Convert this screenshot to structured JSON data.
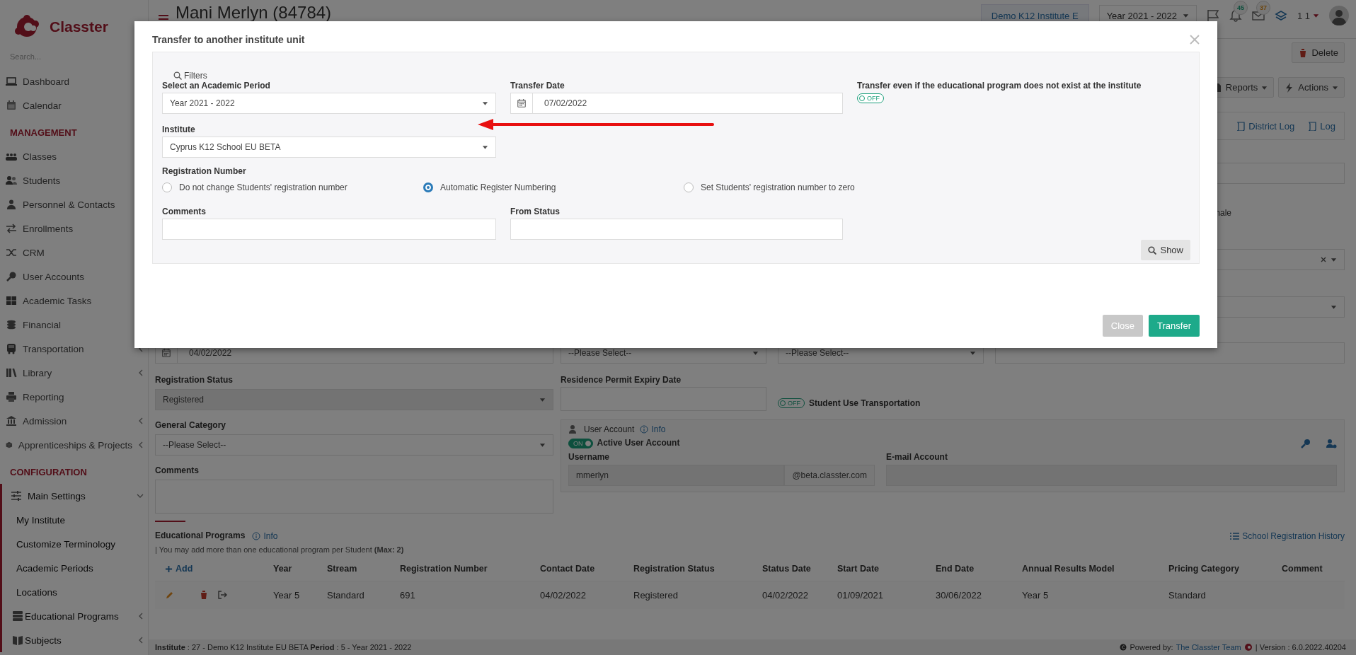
{
  "sidebar": {
    "logo_text": "Classter",
    "search": {
      "placeholder": "Search..."
    },
    "items": [
      {
        "kind": "item",
        "label": "Dashboard"
      },
      {
        "kind": "item",
        "label": "Calendar"
      },
      {
        "kind": "header",
        "label": "MANAGEMENT"
      },
      {
        "kind": "item",
        "label": "Classes"
      },
      {
        "kind": "item",
        "label": "Students"
      },
      {
        "kind": "item",
        "label": "Personnel & Contacts"
      },
      {
        "kind": "item",
        "label": "Enrollments"
      },
      {
        "kind": "item",
        "label": "CRM"
      },
      {
        "kind": "item",
        "label": "User Accounts"
      },
      {
        "kind": "item",
        "label": "Academic Tasks"
      },
      {
        "kind": "item",
        "label": "Financial"
      },
      {
        "kind": "item",
        "label": "Transportation",
        "expanded": false
      },
      {
        "kind": "item",
        "label": "Library",
        "expanded": false
      },
      {
        "kind": "item",
        "label": "Reporting"
      },
      {
        "kind": "item",
        "label": "Admission",
        "expanded": false
      },
      {
        "kind": "item",
        "label": "Apprenticeships & Projects",
        "expanded": false
      },
      {
        "kind": "header",
        "label": "CONFIGURATION"
      },
      {
        "kind": "item",
        "label": "Main Settings",
        "expanded": true,
        "children": [
          {
            "kind": "subitem",
            "label": "My Institute"
          },
          {
            "kind": "subitem",
            "label": "Customize Terminology"
          },
          {
            "kind": "subitem",
            "label": "Academic Periods"
          },
          {
            "kind": "subitem",
            "label": "Locations"
          },
          {
            "kind": "item",
            "label": "Educational Programs",
            "expanded": false
          },
          {
            "kind": "item",
            "label": "Subjects",
            "expanded": false
          }
        ]
      }
    ]
  },
  "header": {
    "title": "Mani Merlyn (84784)",
    "institute": "Demo K12 Institute E",
    "year": "Year 2021 - 2022",
    "notifications": "45",
    "messages": "37",
    "user": "1 1"
  },
  "page_actions": {
    "delete": "Delete",
    "reports": "Reports",
    "actions": "Actions",
    "district_log": "District Log",
    "log": "Log",
    "partial_label": "nale"
  },
  "student_form": {
    "row_fields": [
      {
        "kind": "date",
        "value": "04/02/2022"
      },
      {
        "kind": "select",
        "value": "--Please Select--"
      },
      {
        "kind": "select",
        "value": "--Please Select--"
      },
      {
        "kind": "input"
      }
    ],
    "registration_status": {
      "label": "Registration Status",
      "value": "Registered",
      "disabled": true
    },
    "residence_permit": {
      "label": "Residence Permit Expiry Date"
    },
    "transportation": {
      "label": "Student Use Transportation",
      "on": false,
      "toggle_text": "OFF"
    },
    "general_category": {
      "label": "General Category",
      "value": "--Please Select--"
    },
    "comments": {
      "label": "Comments"
    },
    "user_account": {
      "title": "User Account",
      "info": "Info",
      "active": {
        "label": "Active User Account",
        "on": true,
        "toggle_text": "ON"
      },
      "username_label": "Username",
      "username": "mmerlyn",
      "domain": "@beta.classter.com",
      "email_label": "E-mail Account"
    }
  },
  "educational_programs": {
    "title": "Educational Programs",
    "info": "Info",
    "history": "School Registration History",
    "note": "| You may add more than one educational program per Student **(Max: 2)**",
    "add": "Add",
    "columns": [
      "Year",
      "Stream",
      "Registration Number",
      "Contact Date",
      "Registration Status",
      "Status Date",
      "Start Date",
      "End Date",
      "Annual Results Model",
      "Pricing Category",
      "Comment"
    ],
    "rows": [
      {
        "cells": [
          "Year 5",
          "Standard",
          "691",
          "04/02/2022",
          "Registered",
          "04/02/2022",
          "01/09/2021",
          "30/06/2022",
          "Year 5",
          "Standard"
        ]
      }
    ]
  },
  "footer": {
    "info": "**Institute** : 27 - Demo K12 Institute EU BETA **Period** : 5 - Year 2021 - 2022",
    "powered_by": "Powered by:",
    "team": "The Classter Team",
    "version": "| Version : 6.0.2022.40204"
  },
  "modal": {
    "title": "Transfer to another institute unit",
    "filters_legend": "Filters",
    "academic_period": {
      "label": "Select an Academic Period",
      "value": "Year 2021 - 2022"
    },
    "transfer_date": {
      "label": "Transfer Date",
      "value": "07/02/2022"
    },
    "transfer_even": {
      "label": "Transfer even if the educational program does not exist at the institute",
      "on": false,
      "toggle_text": "OFF"
    },
    "institute": {
      "label": "Institute",
      "value": "Cyprus K12 School EU BETA"
    },
    "registration_number": {
      "label": "Registration Number",
      "options": [
        {
          "label": "Do not change Students' registration number",
          "selected": false
        },
        {
          "label": "Automatic Register Numbering",
          "selected": true
        },
        {
          "label": "Set Students' registration number to zero",
          "selected": false
        }
      ]
    },
    "comments": {
      "label": "Comments"
    },
    "from_status": {
      "label": "From Status"
    },
    "show_button": "Show",
    "buttons": [
      {
        "label": "Close",
        "kind": "secondary"
      },
      {
        "label": "Transfer",
        "kind": "primary"
      }
    ],
    "annotation": {
      "kind": "arrow"
    }
  }
}
